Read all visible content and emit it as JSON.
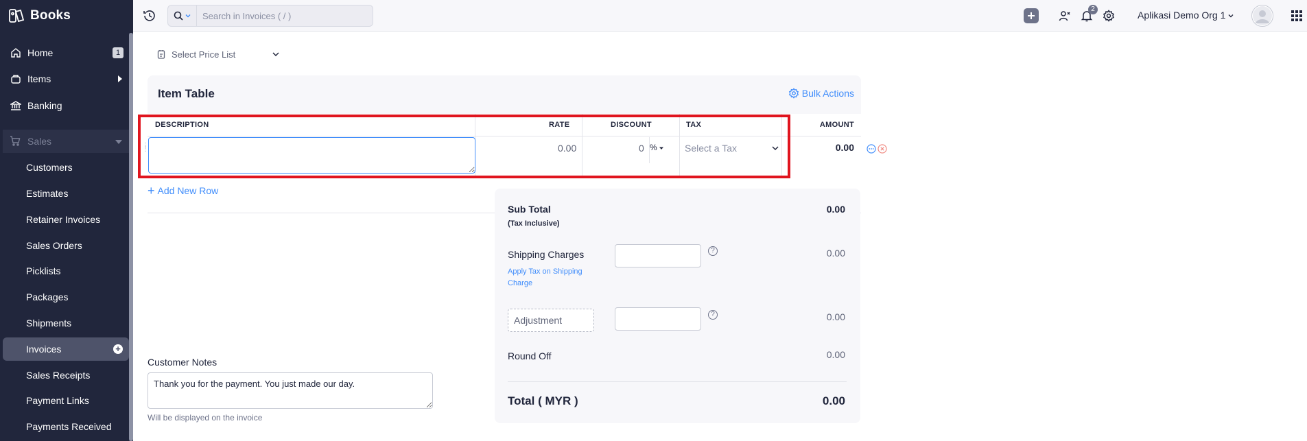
{
  "app": {
    "name": "Books"
  },
  "sidebar": {
    "home": {
      "label": "Home",
      "badge": "1"
    },
    "items": {
      "label": "Items"
    },
    "banking": {
      "label": "Banking"
    },
    "sales": {
      "label": "Sales"
    },
    "sub": [
      "Customers",
      "Estimates",
      "Retainer Invoices",
      "Sales Orders",
      "Picklists",
      "Packages",
      "Shipments",
      "Invoices",
      "Sales Receipts",
      "Payment Links",
      "Payments Received"
    ],
    "active": "Invoices"
  },
  "header": {
    "search_placeholder": "Search in Invoices ( / )",
    "notification_count": "2",
    "org_name": "Aplikasi Demo Org 1"
  },
  "form": {
    "price_list_label": "Select Price List",
    "item_table_title": "Item Table",
    "bulk_actions": "Bulk Actions",
    "columns": {
      "description": "DESCRIPTION",
      "rate": "RATE",
      "discount": "DISCOUNT",
      "tax": "TAX",
      "amount": "AMOUNT"
    },
    "row": {
      "rate": "0.00",
      "discount": "0",
      "discount_unit": "%",
      "tax_placeholder": "Select a Tax",
      "amount": "0.00"
    },
    "add_row": "Add New Row"
  },
  "totals": {
    "sub_total_label": "Sub Total",
    "tax_inclusive": "(Tax Inclusive)",
    "sub_total": "0.00",
    "shipping_label": "Shipping Charges",
    "apply_tax_shipping": "Apply Tax on Shipping Charge",
    "shipping_value": "0.00",
    "adjustment_placeholder": "Adjustment",
    "adjustment_value": "0.00",
    "round_off_label": "Round Off",
    "round_off_value": "0.00",
    "total_label": "Total ( MYR )",
    "total_value": "0.00"
  },
  "notes": {
    "label": "Customer Notes",
    "value": "Thank you for the payment. You just made our day.",
    "hint": "Will be displayed on the invoice"
  },
  "colors": {
    "accent": "#408dfb",
    "sidebar": "#21263c",
    "highlight": "#e0141e"
  }
}
